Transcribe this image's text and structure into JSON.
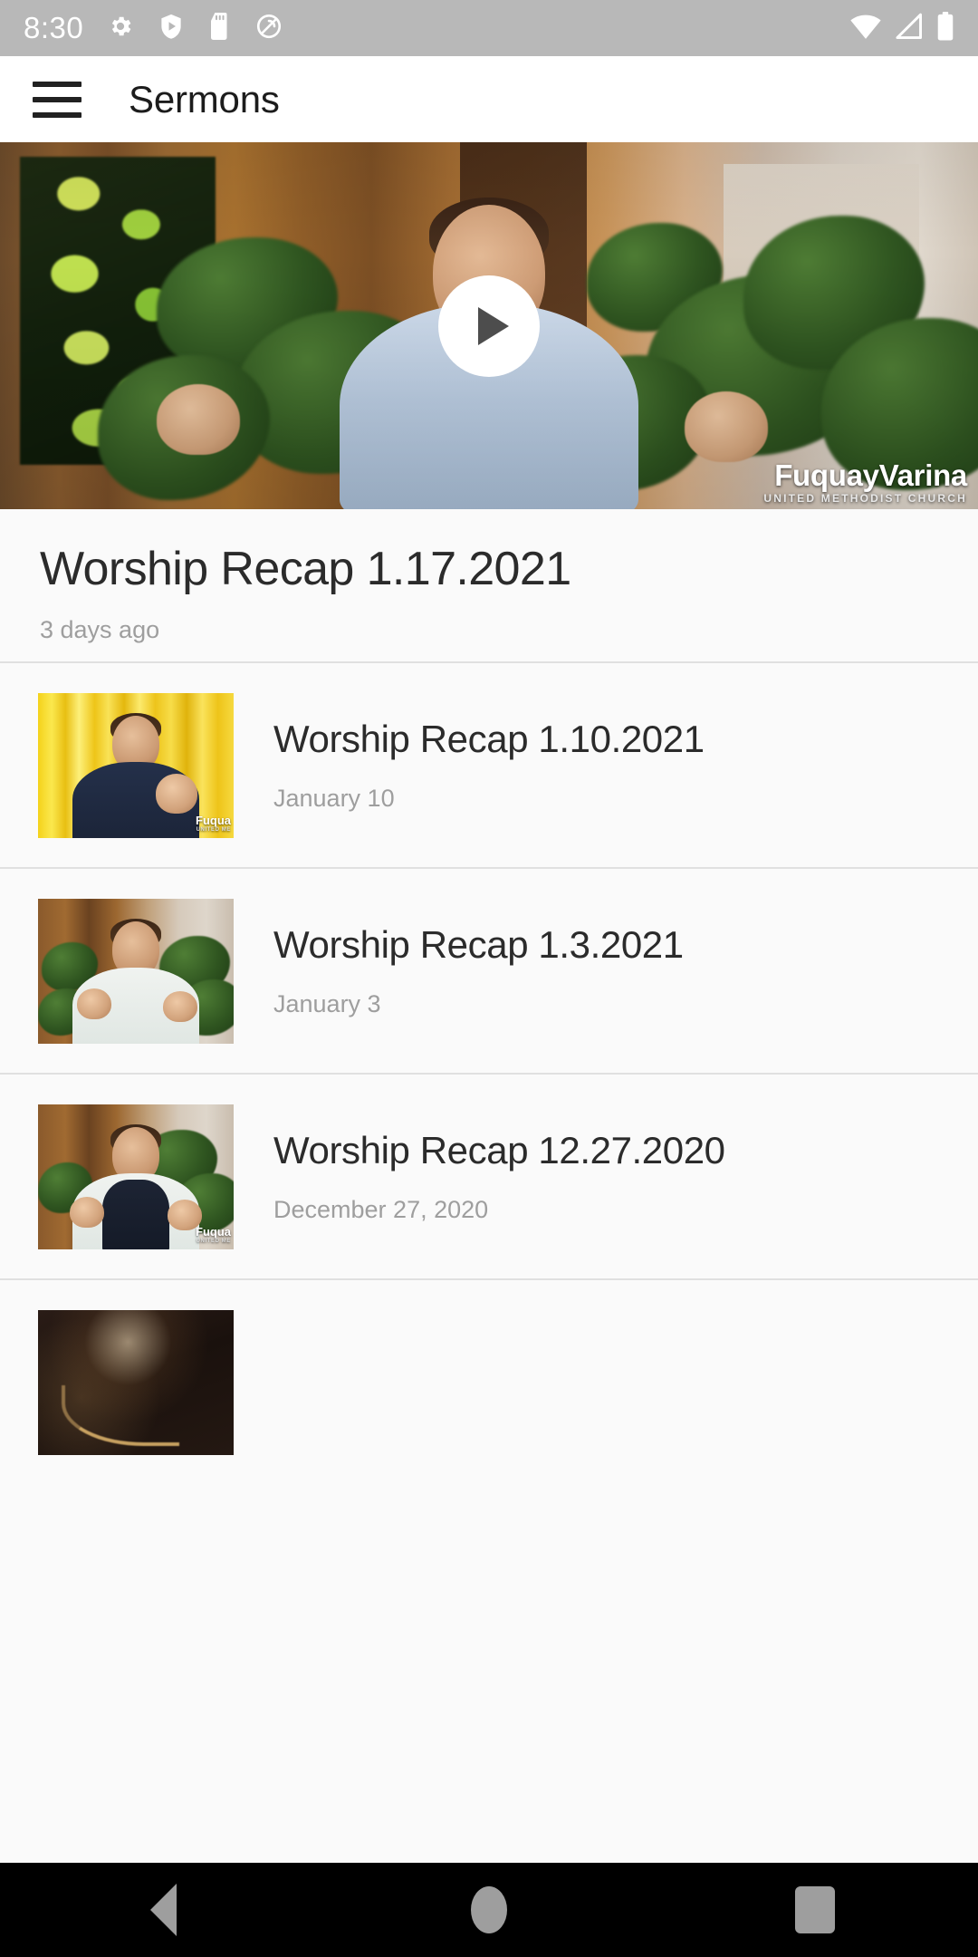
{
  "status_bar": {
    "time": "8:30",
    "left_icons": [
      "gear-icon",
      "play-protect-icon",
      "sd-card-icon",
      "circle-slash-icon"
    ],
    "right_icons": [
      "wifi-icon",
      "cell-signal-icon",
      "battery-icon"
    ],
    "background": "#b8b8b8",
    "foreground": "#ffffff"
  },
  "app_bar": {
    "menu_icon": "hamburger-menu-icon",
    "title": "Sermons",
    "background": "#ffffff",
    "title_color": "#1c1c1c"
  },
  "hero": {
    "play_icon": "play-icon",
    "watermark_main": "FuquayVarina",
    "watermark_sub": "UNITED METHODIST CHURCH",
    "scene": "man-in-light-blue-shirt-gesturing-with-plants-and-wood-paneling"
  },
  "featured": {
    "title": "Worship Recap 1.17.2021",
    "date": "3 days ago",
    "title_color": "#2b2b2b",
    "date_color": "#9e9e9e"
  },
  "list": {
    "items": [
      {
        "title": "Worship Recap 1.10.2021",
        "date": "January 10",
        "thumbnail": "man-in-navy-vest-waving-in-front-of-gold-curtain",
        "watermark_main": "Fuqua",
        "watermark_sub": "UNITED ME"
      },
      {
        "title": "Worship Recap 1.3.2021",
        "date": "January 3",
        "thumbnail": "man-in-white-striped-shirt-gesturing-with-plants",
        "watermark_main": "",
        "watermark_sub": ""
      },
      {
        "title": "Worship Recap 12.27.2020",
        "date": "December 27, 2020",
        "thumbnail": "man-in-dark-vest-over-white-shirt-gesturing-with-plants",
        "watermark_main": "Fuqua",
        "watermark_sub": "UNITED ME"
      },
      {
        "title": "",
        "date": "",
        "thumbnail": "dark-scene-with-warm-gold-script-lettering",
        "watermark_main": "",
        "watermark_sub": ""
      }
    ]
  },
  "nav_bar": {
    "back_label": "Back",
    "home_label": "Home",
    "recents_label": "Recents",
    "background": "#000000",
    "icon_color": "#9e9e9e"
  }
}
